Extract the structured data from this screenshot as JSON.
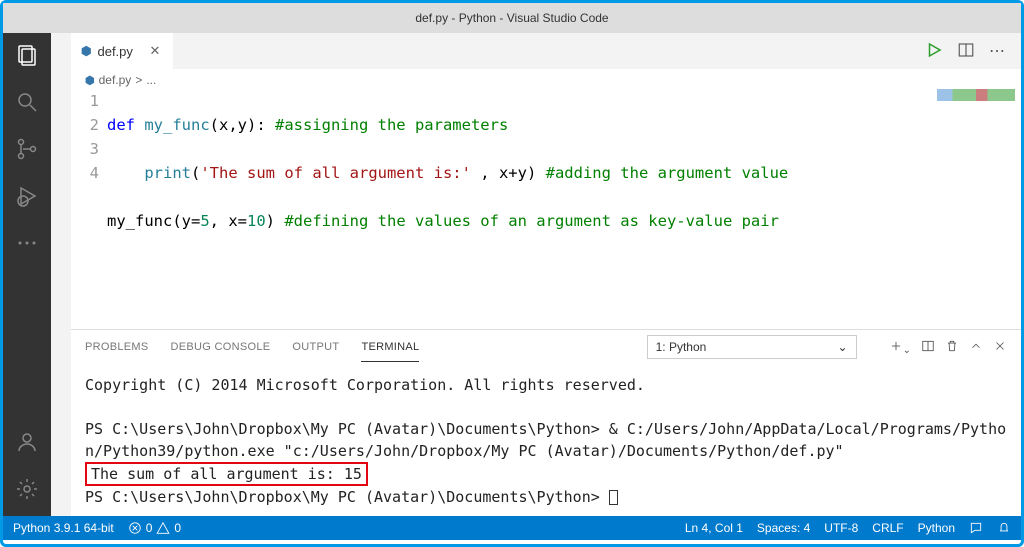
{
  "window": {
    "title": "def.py - Python - Visual Studio Code"
  },
  "tab": {
    "filename": "def.py"
  },
  "breadcrumb": {
    "file": "def.py",
    "sep": ">",
    "more": "..."
  },
  "code": {
    "lines": [
      "1",
      "2",
      "3",
      "4"
    ],
    "l1_def": "def ",
    "l1_fn": "my_func",
    "l1_rest": "(x,y): ",
    "l1_cm": "#assigning the parameters",
    "l2_indent": "    ",
    "l2_print": "print",
    "l2_p1": "(",
    "l2_str": "'The sum of all argument is:'",
    "l2_mid": " , x+y) ",
    "l2_cm": "#adding the argument value",
    "l3_call": "my_func(y=",
    "l3_n1": "5",
    "l3_mid": ", x=",
    "l3_n2": "10",
    "l3_end": ") ",
    "l3_cm": "#defining the values of an argument as key-value pair"
  },
  "panel": {
    "tabs": {
      "problems": "PROBLEMS",
      "debug": "DEBUG CONSOLE",
      "output": "OUTPUT",
      "terminal": "TERMINAL"
    },
    "select": "1: Python"
  },
  "terminal": {
    "copyright": "Copyright (C) 2014 Microsoft Corporation. All rights reserved.",
    "prompt1": "PS C:\\Users\\John\\Dropbox\\My PC (Avatar)\\Documents\\Python> & C:/Users/John/AppData/Local/Programs/Python/Python39/python.exe \"c:/Users/John/Dropbox/My PC (Avatar)/Documents/Python/def.py\"",
    "output": "The sum of all argument is: 15",
    "prompt2": "PS C:\\Users\\John\\Dropbox\\My PC (Avatar)\\Documents\\Python> "
  },
  "status": {
    "python": "Python 3.9.1 64-bit",
    "err": "0",
    "warn": "0",
    "ln": "Ln 4, Col 1",
    "spaces": "Spaces: 4",
    "enc": "UTF-8",
    "eol": "CRLF",
    "lang": "Python"
  }
}
